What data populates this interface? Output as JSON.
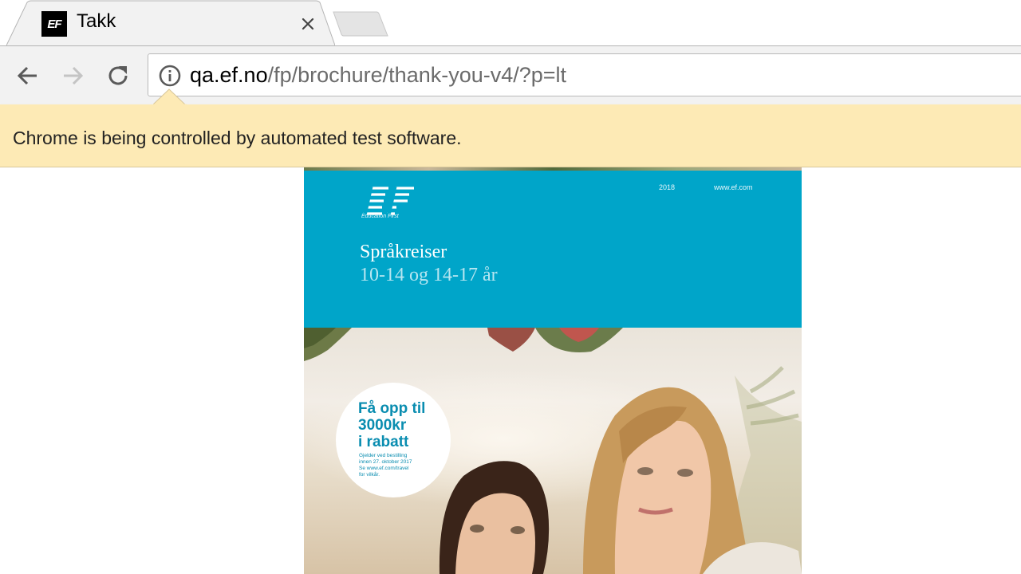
{
  "browser": {
    "tab": {
      "favicon_text": "EF",
      "title": "Takk",
      "close_icon": "close-icon"
    },
    "new_tab_icon": "new-tab-icon",
    "nav": {
      "back_icon": "arrow-left-icon",
      "forward_icon": "arrow-right-icon",
      "reload_icon": "reload-icon"
    },
    "address_bar": {
      "info_icon": "info-icon",
      "url_host": "qa.ef.no",
      "url_path": "/fp/brochure/thank-you-v4/?p=lt"
    },
    "infobar": {
      "message": "Chrome is being controlled by automated test software."
    }
  },
  "page": {
    "brochure": {
      "logo_text": "EF",
      "logo_tagline": "Education First",
      "year": "2018",
      "website": "www.ef.com",
      "title": "Språkreiser",
      "subtitle": "10-14 og 14-17 år",
      "badge": {
        "line1": "Få opp til",
        "line2": "3000kr",
        "line3": "i rabatt",
        "fine_print_1": "Gjelder ved bestilling",
        "fine_print_2": "innen 27. oktober 2017",
        "fine_print_3": "Se www.ef.com/travel",
        "fine_print_4": "for vilkår."
      }
    }
  },
  "colors": {
    "brochure_header": "#00a5c9",
    "infobar_bg": "#fdeab5",
    "badge_text": "#0a8db0"
  }
}
